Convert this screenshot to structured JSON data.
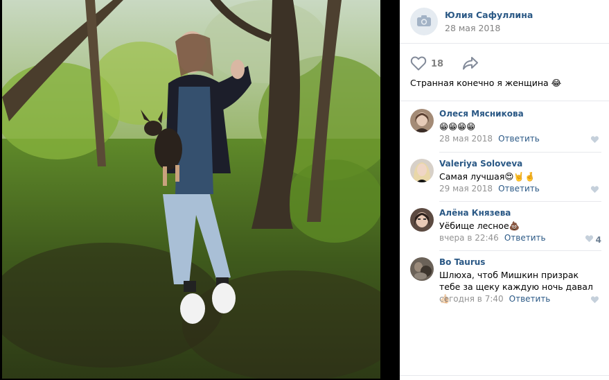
{
  "owner": {
    "name": "Юлия Сафуллина",
    "date": "28 мая 2018",
    "avatar_icon": "camera-icon"
  },
  "post": {
    "like_count": "18",
    "like_icon": "heart-outline-icon",
    "share_icon": "share-arrow-icon",
    "caption": "Странная конечно я женщина 😂"
  },
  "comments": [
    {
      "author": "Олеся Мясникова",
      "text": "😁😁😁😁",
      "date": "28 мая 2018",
      "reply": "Ответить",
      "likes": ""
    },
    {
      "author": "Valeriya Soloveva",
      "text": "Самая лучшая😍🤘🤞",
      "date": "29 мая 2018",
      "reply": "Ответить",
      "likes": ""
    },
    {
      "author": "Алёна Князева",
      "text": "Уёбище лесное💩",
      "date": "вчера в 22:46",
      "reply": "Ответить",
      "likes": "4"
    },
    {
      "author": "Bo Taurus",
      "text": "Шлюха, чтоб Мишкин призрак тебе за щеку каждую ночь давал👍🏻",
      "date": "сегодня в 7:40",
      "reply": "Ответить",
      "likes": ""
    }
  ],
  "colors": {
    "link": "#2a5885",
    "muted": "#828282",
    "separator": "#e7e8ec",
    "photo_background": "#000000"
  }
}
